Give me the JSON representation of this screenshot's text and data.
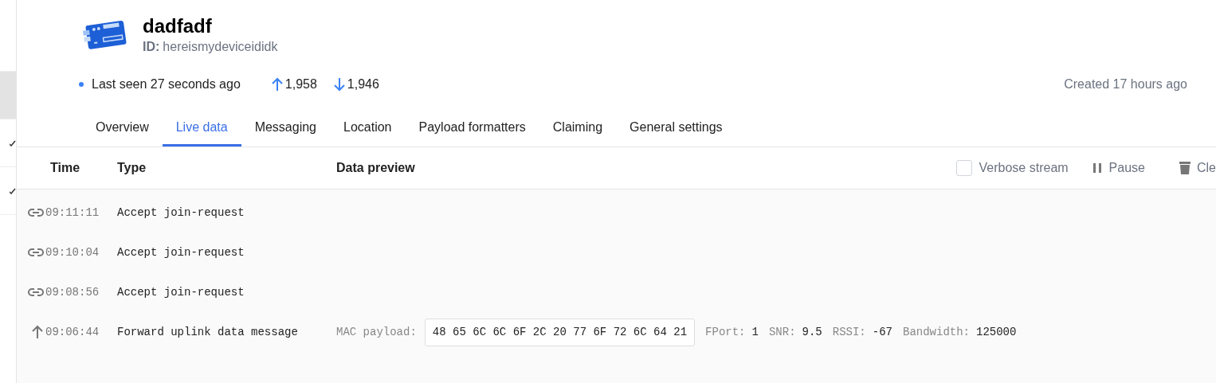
{
  "sidebar": {
    "items": [
      {
        "selected": false
      },
      {
        "selected": true
      },
      {
        "selected": false,
        "checked": true
      },
      {
        "selected": false,
        "checked": true
      }
    ]
  },
  "device": {
    "name": "dadfadf",
    "id_label": "ID:",
    "id": "hereismydeviceididk",
    "status": "Last seen 27 seconds ago",
    "uplinks": "1,958",
    "downlinks": "1,946",
    "created": "Created 17 hours ago"
  },
  "tabs": [
    {
      "label": "Overview",
      "selected": false
    },
    {
      "label": "Live data",
      "selected": true
    },
    {
      "label": "Messaging",
      "selected": false
    },
    {
      "label": "Location",
      "selected": false
    },
    {
      "label": "Payload formatters",
      "selected": false
    },
    {
      "label": "Claiming",
      "selected": false
    },
    {
      "label": "General settings",
      "selected": false
    }
  ],
  "table": {
    "columns": [
      "Time",
      "Type",
      "Data preview"
    ],
    "verbose": {
      "label": "Verbose stream",
      "checked": false
    },
    "pause": "Pause",
    "clear": "Cle",
    "rows": [
      {
        "kind": "join",
        "time": "09:11:11",
        "type": "Accept join-request"
      },
      {
        "kind": "join",
        "time": "09:10:04",
        "type": "Accept join-request"
      },
      {
        "kind": "join",
        "time": "09:08:56",
        "type": "Accept join-request"
      },
      {
        "kind": "uplink",
        "time": "09:06:44",
        "type": "Forward uplink data message",
        "payload_label": "MAC payload:",
        "payload": "48 65 6C 6C 6F 2C 20 77 6F 72 6C 64 21",
        "fields": [
          {
            "label": "FPort:",
            "value": "1"
          },
          {
            "label": "SNR:",
            "value": "9.5"
          },
          {
            "label": "RSSI:",
            "value": "-67"
          },
          {
            "label": "Bandwidth:",
            "value": "125000"
          }
        ]
      }
    ]
  }
}
